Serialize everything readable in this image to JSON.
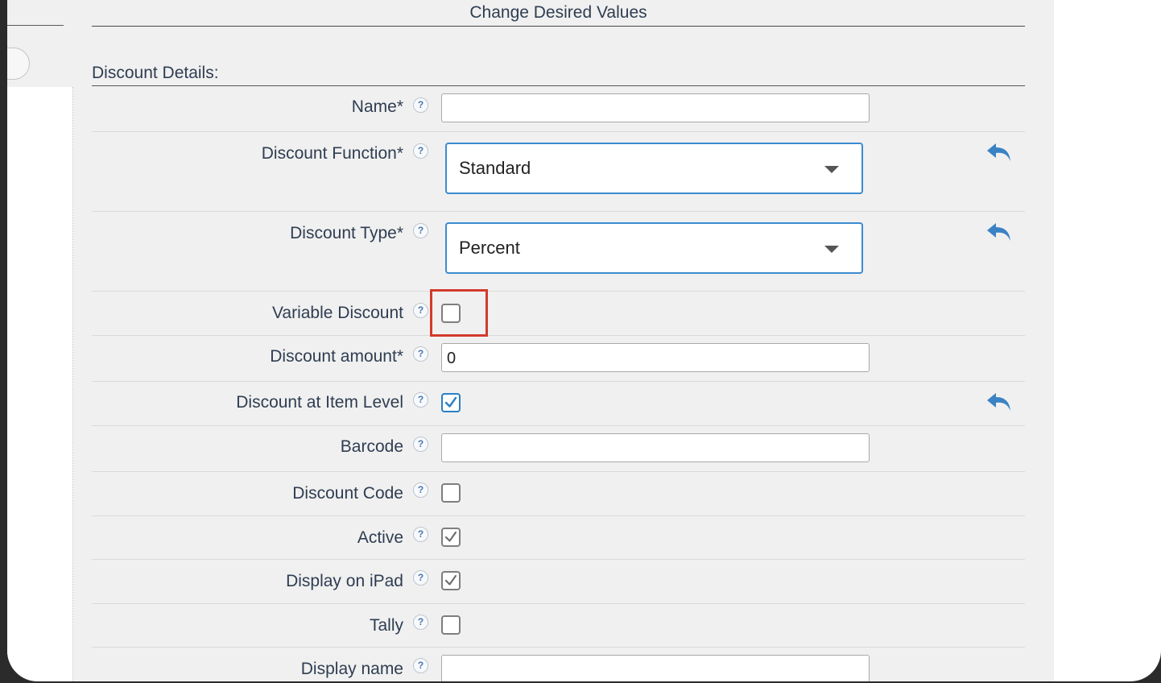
{
  "dialog": {
    "title": "Change Desired Values"
  },
  "section": {
    "title": "Discount Details:"
  },
  "fields": {
    "name": {
      "label": "Name*",
      "value": ""
    },
    "discount_function": {
      "label": "Discount Function*",
      "value": "Standard"
    },
    "discount_type": {
      "label": "Discount Type*",
      "value": "Percent"
    },
    "variable_discount": {
      "label": "Variable Discount",
      "checked": false
    },
    "discount_amount": {
      "label": "Discount amount*",
      "value": "0"
    },
    "discount_at_item_level": {
      "label": "Discount at Item Level",
      "checked": true
    },
    "barcode": {
      "label": "Barcode",
      "value": ""
    },
    "discount_code": {
      "label": "Discount Code",
      "checked": false
    },
    "active": {
      "label": "Active",
      "checked": true
    },
    "display_on_ipad": {
      "label": "Display on iPad",
      "checked": true
    },
    "tally": {
      "label": "Tally",
      "checked": false
    },
    "display_name": {
      "label": "Display name",
      "value": ""
    }
  },
  "help_glyph": "?",
  "icons": {
    "help": "help-circle-icon",
    "undo": "undo-arrow-icon",
    "dropdown": "caret-down-icon"
  },
  "colors": {
    "accent": "#3b8bd0",
    "highlight": "#d33a2c",
    "text": "#2f3d52"
  }
}
